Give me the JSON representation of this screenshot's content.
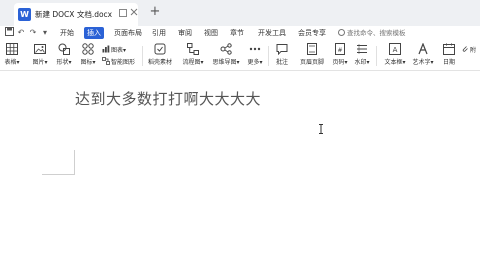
{
  "titlebar": {
    "doc_title": "新建 DOCX 文档.docx",
    "new_tab_symbol": "+"
  },
  "quick_access": {
    "save_symbol": "☐",
    "undo_symbol": "↶",
    "redo_symbol": "↷"
  },
  "menu": {
    "items": [
      {
        "label": "开始"
      },
      {
        "label": "插入"
      },
      {
        "label": "页面布局"
      },
      {
        "label": "引用"
      },
      {
        "label": "审阅"
      },
      {
        "label": "视图"
      },
      {
        "label": "章节"
      },
      {
        "label": "开发工具"
      },
      {
        "label": "会员专享"
      }
    ],
    "active_index": 1,
    "search_placeholder": "查找命令、搜索模板"
  },
  "ribbon": {
    "buttons": [
      {
        "label": "表格▾",
        "icon": "table-icon"
      },
      {
        "label": "图片▾",
        "icon": "picture-icon"
      },
      {
        "label": "形状▾",
        "icon": "shape-icon"
      },
      {
        "label": "图标▾",
        "icon": "icons-icon"
      },
      {
        "label": "稻壳素材",
        "icon": "material-icon"
      },
      {
        "label": "流程图▾",
        "icon": "flowchart-icon"
      },
      {
        "label": "思维导图▾",
        "icon": "mindmap-icon"
      },
      {
        "label": "更多▾",
        "icon": "more-icon"
      },
      {
        "label": "批注",
        "icon": "comment-icon"
      },
      {
        "label": "页眉页脚",
        "icon": "header-footer-icon"
      },
      {
        "label": "页码▾",
        "icon": "page-number-icon"
      },
      {
        "label": "水印▾",
        "icon": "watermark-icon"
      },
      {
        "label": "文本框▾",
        "icon": "textbox-icon"
      },
      {
        "label": "艺术字▾",
        "icon": "art-text-icon"
      },
      {
        "label": "日期",
        "icon": "date-icon"
      },
      {
        "label": "附",
        "icon": "attachment-icon"
      }
    ],
    "small": {
      "chart_label": "图表",
      "smartart_label": "智能图形"
    }
  },
  "document": {
    "text": "达到大多数打打啊大大大大"
  },
  "colors": {
    "accent": "#2b62d6",
    "titlebar_bg": "#eef0f3"
  }
}
